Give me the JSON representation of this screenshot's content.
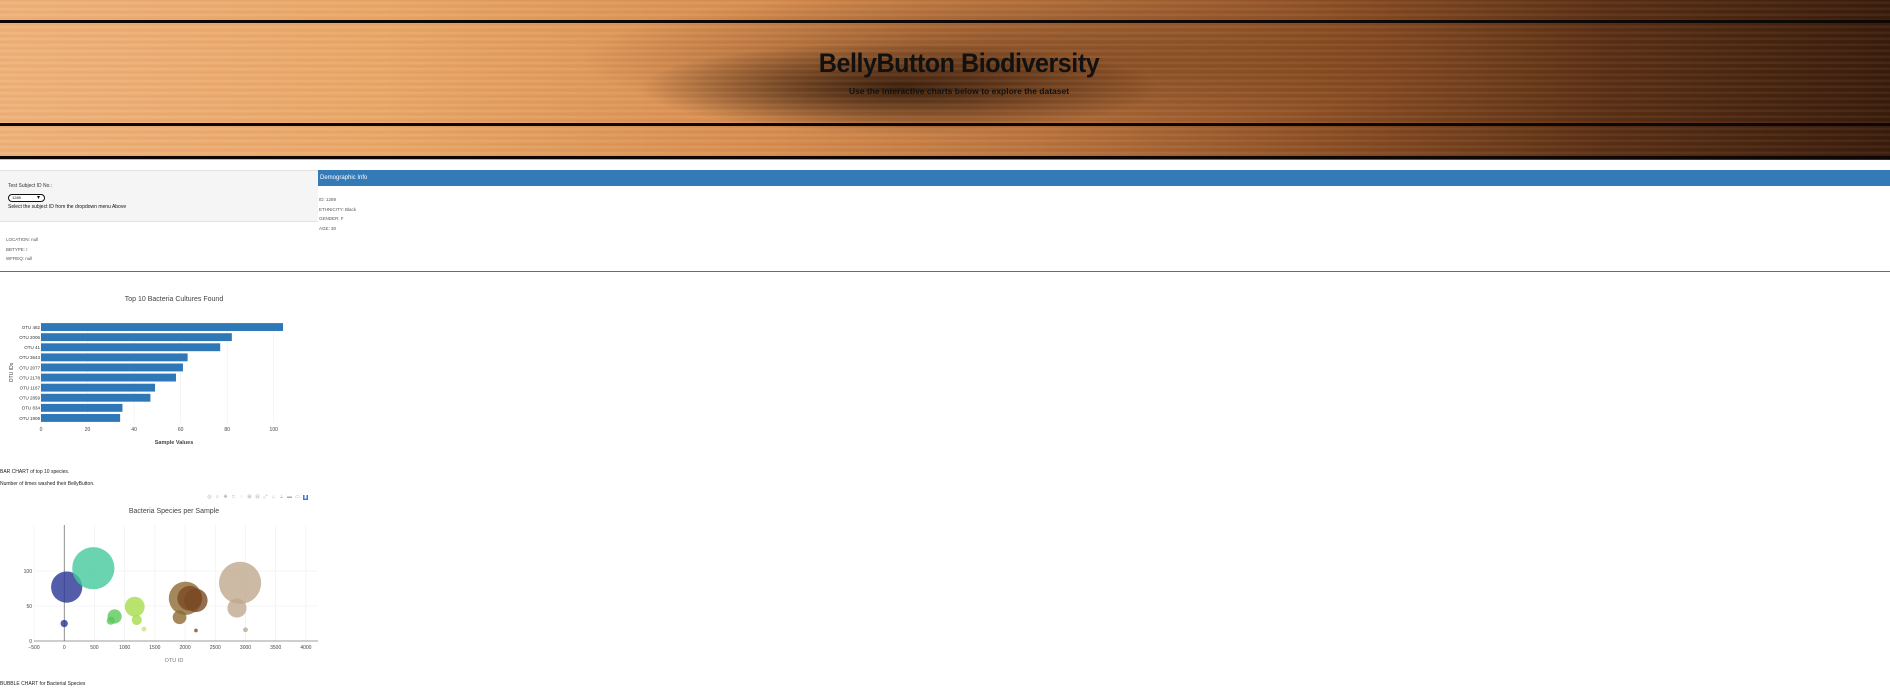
{
  "header": {
    "title": "BellyButton Biodiversity",
    "subtitle": "Use the interactive charts below to explore the dataset"
  },
  "selector": {
    "label": "Test Subject ID No.:",
    "selected": "1289",
    "hint": "Select the subject ID from the dropdown menu Above"
  },
  "extra_info": {
    "location": "LOCATION: null",
    "bbtype": "BBTYPE: I",
    "wfreq": "WFREQ: null"
  },
  "demographic": {
    "heading": "Demographic Info",
    "id": "ID: 1289",
    "ethnicity": "ETHNICITY: Black",
    "gender": "GENDER: F",
    "age": "AGE: 30"
  },
  "captions": {
    "bar1": "BAR CHART of top 10 species.",
    "bar2": "Number of times washed their BellyButton.",
    "bubble": "BUBBLE CHART for Bacterial Species"
  },
  "modebar_icons": [
    "camera-icon",
    "zoom-icon",
    "pan-icon",
    "box-select-icon",
    "lasso-icon",
    "zoom-in-icon",
    "zoom-out-icon",
    "autoscale-icon",
    "reset-axes-icon",
    "spike-icon",
    "hover-closest-icon",
    "hover-compare-icon",
    "plotly-logo-icon"
  ],
  "colors": {
    "accent": "#337ab7",
    "bar": "#2f78b7"
  },
  "chart_data": [
    {
      "type": "bar",
      "orientation": "horizontal",
      "title": "Top 10 Bacteria Cultures Found",
      "xlabel": "Sample Values",
      "ylabel": "OTU IDs",
      "categories": [
        "OTU 482",
        "OTU 2006",
        "OTU 41",
        "OTU 3643",
        "OTU 2077",
        "OTU 2178",
        "OTU 1167",
        "OTU 2859",
        "OTU 834",
        "OTU 1909"
      ],
      "values": [
        104,
        82,
        77,
        63,
        61,
        58,
        49,
        47,
        35,
        34
      ],
      "xlim": [
        0,
        110
      ],
      "xticks": [
        0,
        20,
        40,
        60,
        80,
        100
      ],
      "grid": true
    },
    {
      "type": "scatter",
      "subtype": "bubble",
      "title": "Bacteria Species per Sample",
      "xlabel": "OTU ID",
      "ylabel": "",
      "xlim": [
        -500,
        4200
      ],
      "ylim": [
        0,
        180
      ],
      "xticks": [
        -500,
        0,
        500,
        1000,
        1500,
        2000,
        2500,
        3000,
        3500,
        4000
      ],
      "xtick_labels": [
        "−500",
        "0",
        "500",
        "1000",
        "1500",
        "2000",
        "2500",
        "3000",
        "3500",
        "4000"
      ],
      "yticks": [
        0,
        50,
        100
      ],
      "points": [
        {
          "x": 41,
          "y": 77,
          "size": 77,
          "color": "#283593"
        },
        {
          "x": 0,
          "y": 25,
          "size": 18,
          "color": "#283593"
        },
        {
          "x": 482,
          "y": 104,
          "size": 104,
          "color": "#43c99b"
        },
        {
          "x": 834,
          "y": 35,
          "size": 35,
          "color": "#5ac85a"
        },
        {
          "x": 770,
          "y": 29,
          "size": 20,
          "color": "#5ac85a"
        },
        {
          "x": 1167,
          "y": 49,
          "size": 49,
          "color": "#a5dc4a"
        },
        {
          "x": 1200,
          "y": 30,
          "size": 25,
          "color": "#a5dc4a"
        },
        {
          "x": 1320,
          "y": 17,
          "size": 12,
          "color": "#c9e57a"
        },
        {
          "x": 1909,
          "y": 34,
          "size": 34,
          "color": "#8d6a33"
        },
        {
          "x": 2006,
          "y": 61,
          "size": 82,
          "color": "#8d6a33"
        },
        {
          "x": 2077,
          "y": 61,
          "size": 61,
          "color": "#7a4a24"
        },
        {
          "x": 2178,
          "y": 58,
          "size": 58,
          "color": "#7a4a24"
        },
        {
          "x": 2180,
          "y": 15,
          "size": 9,
          "color": "#7a4a24"
        },
        {
          "x": 2859,
          "y": 47,
          "size": 47,
          "color": "#bfa98f"
        },
        {
          "x": 2910,
          "y": 83,
          "size": 104,
          "color": "#bfa98f"
        },
        {
          "x": 3000,
          "y": 16,
          "size": 12,
          "color": "#bfa98f"
        }
      ]
    }
  ]
}
